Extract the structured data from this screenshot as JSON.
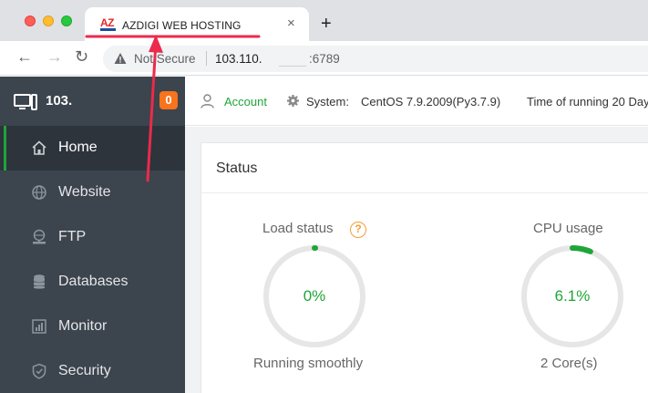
{
  "browser": {
    "tab_title": "AZDIGI WEB HOSTING",
    "tab_logo_text": "AZ",
    "close_glyph": "×",
    "new_tab_glyph": "+",
    "back_glyph": "←",
    "forward_glyph": "→",
    "reload_glyph": "↻",
    "security_label": "Not Secure",
    "url_host": "103.110.",
    "url_port": ":6789"
  },
  "sidebar": {
    "server_name": "103.",
    "notification_count": "0",
    "items": [
      {
        "label": "Home",
        "icon": "home-icon",
        "active": true
      },
      {
        "label": "Website",
        "icon": "globe-icon",
        "active": false
      },
      {
        "label": "FTP",
        "icon": "ftp-icon",
        "active": false
      },
      {
        "label": "Databases",
        "icon": "database-icon",
        "active": false
      },
      {
        "label": "Monitor",
        "icon": "monitor-icon",
        "active": false
      },
      {
        "label": "Security",
        "icon": "shield-icon",
        "active": false
      }
    ]
  },
  "header": {
    "account_label": "Account",
    "system_label": "System:",
    "system_value": "CentOS 7.9.2009(Py3.7.9)",
    "running_time": "Time of running 20 Day"
  },
  "status": {
    "title": "Status",
    "metrics": [
      {
        "title": "Load status",
        "value": "0%",
        "caption": "Running smoothly",
        "percent": 0,
        "has_help": true,
        "help_glyph": "?"
      },
      {
        "title": "CPU usage",
        "value": "6.1%",
        "caption": "2 Core(s)",
        "percent": 6.1,
        "has_help": false
      }
    ]
  },
  "colors": {
    "accent_green": "#20a53a",
    "sidebar_bg": "#3c444d",
    "badge_orange": "#f7731c",
    "annotation_red": "#ec2a4b",
    "help_orange": "#f29d38"
  }
}
